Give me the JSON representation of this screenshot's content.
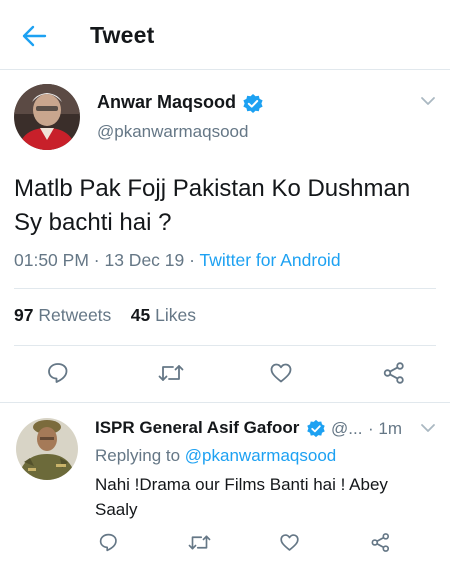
{
  "header": {
    "title": "Tweet",
    "back_icon": "arrow-left-icon",
    "accent_color": "#1da1f2"
  },
  "tweet": {
    "author_name": "Anwar Maqsood",
    "author_handle": "@pkanwarmaqsood",
    "verified": true,
    "text": "Matlb Pak Fojj Pakistan Ko Dushman Sy bachti hai ?",
    "time": "01:50 PM",
    "date": "13 Dec 19",
    "separator": "·",
    "source": "Twitter for Android",
    "retweets_count": "97",
    "retweets_label": "Retweets",
    "likes_count": "45",
    "likes_label": "Likes",
    "actions": [
      "reply-icon",
      "retweet-icon",
      "like-icon",
      "share-icon"
    ]
  },
  "reply": {
    "author_name": "ISPR General Asif Gafoor",
    "author_handle": "@...",
    "verified": true,
    "time": "1m",
    "replying_prefix": "Replying to",
    "replying_to": "@pkanwarmaqsood",
    "text": "Nahi !Drama our Films Banti hai ! Abey Saaly",
    "actions": [
      "reply-icon",
      "retweet-icon",
      "like-icon",
      "share-icon"
    ]
  },
  "colors": {
    "text_primary": "#14171a",
    "text_secondary": "#657786",
    "link": "#1da1f2",
    "divider": "#e1e8ed"
  }
}
